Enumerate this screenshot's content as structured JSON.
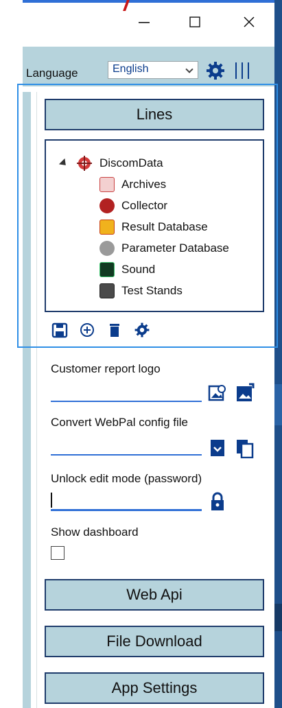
{
  "window": {
    "minimize_glyph": "—",
    "maximize_glyph": "☐",
    "close_glyph": "✕"
  },
  "header": {
    "language_label": "Language",
    "language_value": "English"
  },
  "lines": {
    "button_label": "Lines",
    "tree": {
      "root": "DiscomData",
      "items": [
        {
          "label": "Archives",
          "icon": "archives-icon",
          "color": "#c94141"
        },
        {
          "label": "Collector",
          "icon": "collector-icon",
          "color": "#b22222"
        },
        {
          "label": "Result Database",
          "icon": "result-database-icon",
          "color": "#e3a21a"
        },
        {
          "label": "Parameter Database",
          "icon": "parameter-database-icon",
          "color": "#7a7a7a"
        },
        {
          "label": "Sound",
          "icon": "sound-icon",
          "color": "#1d6a3a"
        },
        {
          "label": "Test Stands",
          "icon": "test-stands-icon",
          "color": "#3a3a3a"
        }
      ]
    }
  },
  "settings": {
    "customer_logo_label": "Customer report logo",
    "webpal_label": "Convert WebPal config file",
    "unlock_label": "Unlock edit mode (password)",
    "dashboard_label": "Show dashboard"
  },
  "buttons": {
    "web_api": "Web Api",
    "file_download": "File Download",
    "app_settings": "App Settings"
  },
  "colors": {
    "accent": "#1e3b6b",
    "button_bg": "#b6d3dc",
    "underline": "#2f6fd6"
  }
}
